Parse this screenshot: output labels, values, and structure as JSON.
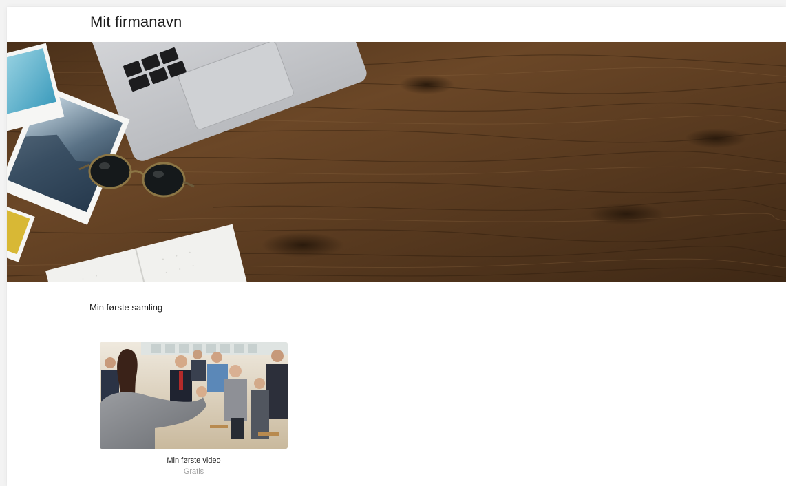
{
  "header": {
    "title": "Mit firmanavn"
  },
  "collection": {
    "heading": "Min første samling",
    "items": [
      {
        "title": "Min første video",
        "price": "Gratis"
      }
    ]
  },
  "colors": {
    "wood": "#5a3c22",
    "rule": "#e4e4e4",
    "price": "#a0a0a0"
  }
}
